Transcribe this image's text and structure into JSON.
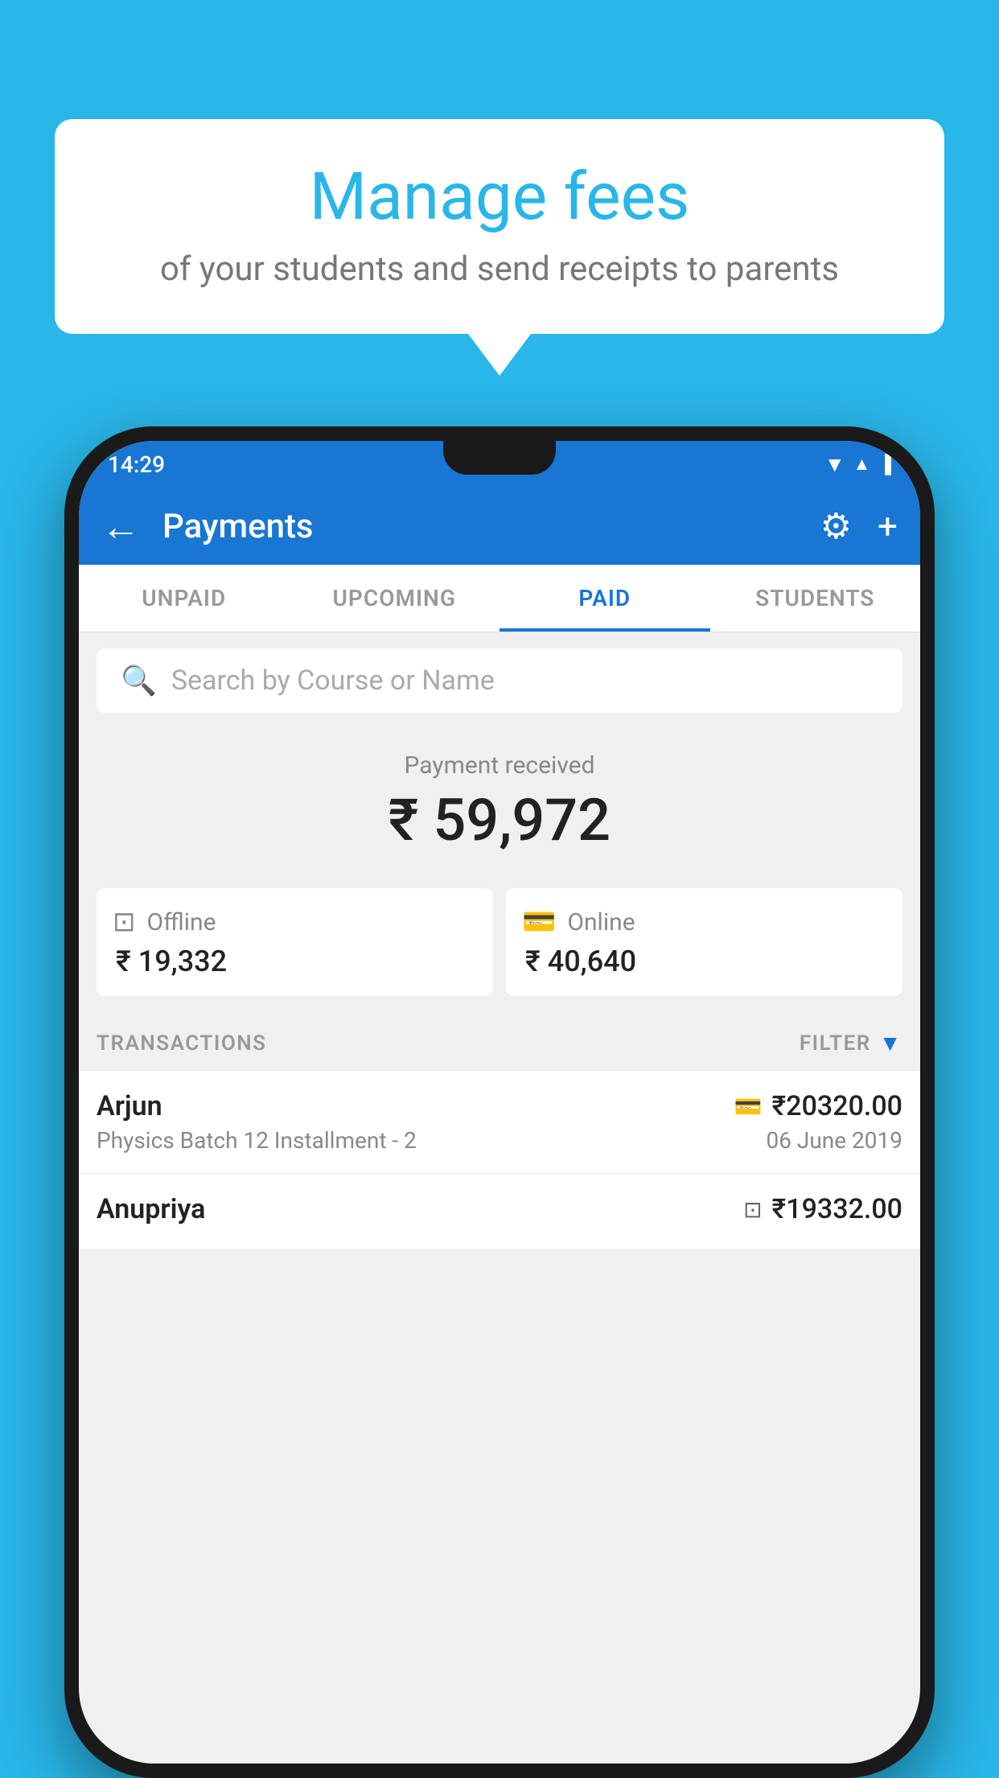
{
  "background_color": "#29b6e8",
  "speech_bubble": {
    "title": "Manage fees",
    "subtitle": "of your students and send receipts to parents"
  },
  "status_bar": {
    "time": "14:29",
    "icons": [
      "wifi",
      "signal",
      "battery"
    ]
  },
  "app_bar": {
    "title": "Payments",
    "back_label": "←",
    "settings_icon": "⚙",
    "add_icon": "+"
  },
  "tabs": [
    {
      "label": "UNPAID",
      "active": false
    },
    {
      "label": "UPCOMING",
      "active": false
    },
    {
      "label": "PAID",
      "active": true
    },
    {
      "label": "STUDENTS",
      "active": false
    }
  ],
  "search": {
    "placeholder": "Search by Course or Name"
  },
  "payment_summary": {
    "label": "Payment received",
    "amount": "₹ 59,972",
    "offline": {
      "label": "Offline",
      "amount": "₹ 19,332"
    },
    "online": {
      "label": "Online",
      "amount": "₹ 40,640"
    }
  },
  "transactions": {
    "label": "TRANSACTIONS",
    "filter_label": "FILTER",
    "rows": [
      {
        "name": "Arjun",
        "course": "Physics Batch 12 Installment - 2",
        "amount": "₹20320.00",
        "date": "06 June 2019",
        "type": "online"
      },
      {
        "name": "Anupriya",
        "course": "",
        "amount": "₹19332.00",
        "date": "",
        "type": "offline"
      }
    ]
  }
}
